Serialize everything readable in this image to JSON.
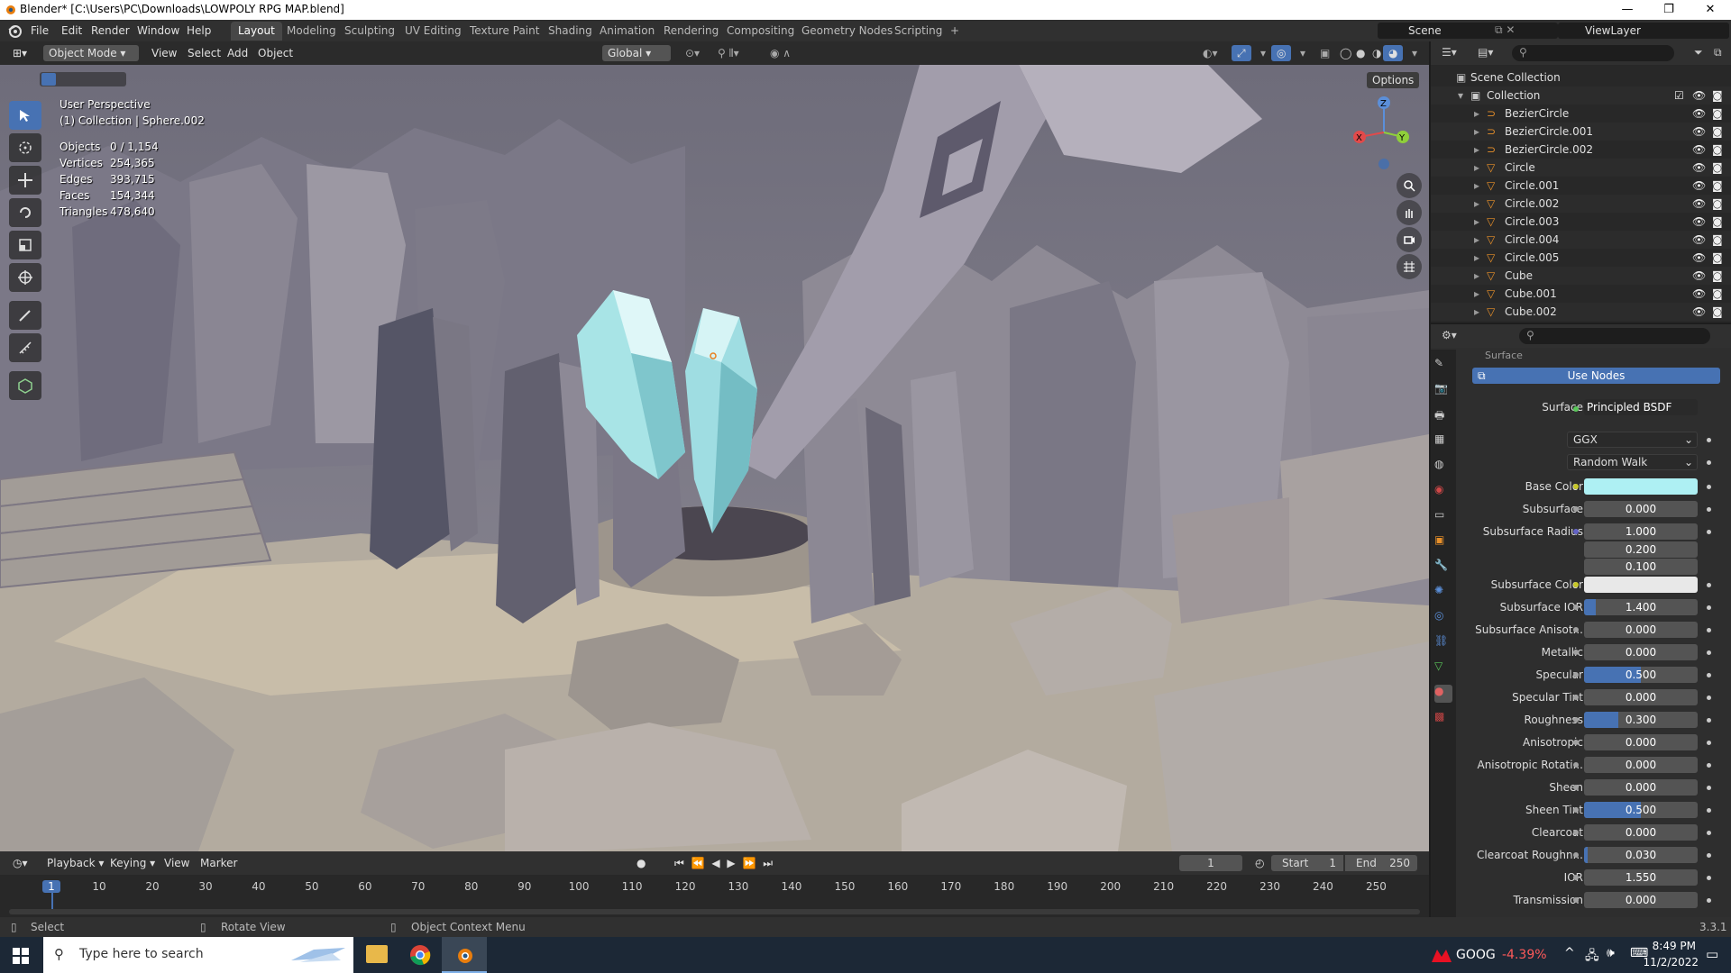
{
  "window": {
    "title": "Blender* [C:\\Users\\PC\\Downloads\\LOWPOLY RPG MAP.blend]",
    "controls": [
      "—",
      "❐",
      "✕"
    ]
  },
  "menu": [
    "File",
    "Edit",
    "Render",
    "Window",
    "Help"
  ],
  "workspaces": [
    "Layout",
    "Modeling",
    "Sculpting",
    "UV Editing",
    "Texture Paint",
    "Shading",
    "Animation",
    "Rendering",
    "Compositing",
    "Geometry Nodes",
    "Scripting",
    "+"
  ],
  "scene": {
    "label": "Scene",
    "viewlayer": "ViewLayer"
  },
  "viewport_header": {
    "mode": "Object Mode",
    "view": "View",
    "select": "Select",
    "add": "Add",
    "object": "Object",
    "orientation": "Global",
    "options": "Options"
  },
  "overlay": {
    "perspective": "User Perspective",
    "collection": "(1) Collection | Sphere.002",
    "stats": [
      {
        "label": "Objects",
        "value": "0 / 1,154"
      },
      {
        "label": "Vertices",
        "value": "254,365"
      },
      {
        "label": "Edges",
        "value": "393,715"
      },
      {
        "label": "Faces",
        "value": "154,344"
      },
      {
        "label": "Triangles",
        "value": "478,640"
      }
    ],
    "gizmo_axes": {
      "x": "X",
      "y": "Y",
      "z": "Z"
    }
  },
  "tools": [
    "select-box-icon",
    "cursor-icon",
    "move-icon",
    "rotate-icon",
    "scale-icon",
    "transform-icon",
    "annotate-icon",
    "measure-icon",
    "add-cube-icon"
  ],
  "outliner": {
    "root": "Scene Collection",
    "collection": "Collection",
    "items": [
      {
        "name": "BezierCircle",
        "type": "curve"
      },
      {
        "name": "BezierCircle.001",
        "type": "curve"
      },
      {
        "name": "BezierCircle.002",
        "type": "curve"
      },
      {
        "name": "Circle",
        "type": "mesh"
      },
      {
        "name": "Circle.001",
        "type": "mesh"
      },
      {
        "name": "Circle.002",
        "type": "mesh"
      },
      {
        "name": "Circle.003",
        "type": "mesh"
      },
      {
        "name": "Circle.004",
        "type": "mesh"
      },
      {
        "name": "Circle.005",
        "type": "mesh"
      },
      {
        "name": "Cube",
        "type": "mesh"
      },
      {
        "name": "Cube.001",
        "type": "mesh"
      },
      {
        "name": "Cube.002",
        "type": "mesh"
      }
    ]
  },
  "properties": {
    "section": "Surface",
    "use_nodes": "Use Nodes",
    "surface_label": "Surface",
    "surface_value": "Principled BSDF",
    "distribution": "GGX",
    "subsurface_method": "Random Walk",
    "rows": [
      {
        "label": "Base Color",
        "type": "color",
        "color": "#aef0f3",
        "dot": "y"
      },
      {
        "label": "Subsurface",
        "value": "0.000",
        "fill": 0
      },
      {
        "label": "Subsurface Radius",
        "value": "1.000",
        "fill": 0,
        "dot": "p"
      },
      {
        "label": "",
        "value": "0.200",
        "fill": 0,
        "nodot": true
      },
      {
        "label": "",
        "value": "0.100",
        "fill": 0,
        "nodot": true
      },
      {
        "label": "Subsurface Color",
        "type": "color",
        "color": "#e8e8e8",
        "dot": "y"
      },
      {
        "label": "Subsurface IOR",
        "value": "1.400",
        "fill": 0.1
      },
      {
        "label": "Subsurface Anisot...",
        "value": "0.000",
        "fill": 0
      },
      {
        "label": "Metallic",
        "value": "0.000",
        "fill": 0
      },
      {
        "label": "Specular",
        "value": "0.500",
        "fill": 0.5
      },
      {
        "label": "Specular Tint",
        "value": "0.000",
        "fill": 0
      },
      {
        "label": "Roughness",
        "value": "0.300",
        "fill": 0.3
      },
      {
        "label": "Anisotropic",
        "value": "0.000",
        "fill": 0
      },
      {
        "label": "Anisotropic Rotati...",
        "value": "0.000",
        "fill": 0
      },
      {
        "label": "Sheen",
        "value": "0.000",
        "fill": 0
      },
      {
        "label": "Sheen Tint",
        "value": "0.500",
        "fill": 0.5
      },
      {
        "label": "Clearcoat",
        "value": "0.000",
        "fill": 0
      },
      {
        "label": "Clearcoat Roughn...",
        "value": "0.030",
        "fill": 0.03
      },
      {
        "label": "IOR",
        "value": "1.550",
        "fill": 0
      },
      {
        "label": "Transmission",
        "value": "0.000",
        "fill": 0
      }
    ]
  },
  "timeline": {
    "menus": [
      "Playback",
      "Keying",
      "View",
      "Marker"
    ],
    "current_frame": "1",
    "start_label": "Start",
    "start": "1",
    "end_label": "End",
    "end": "250",
    "ticks": [
      "1",
      "10",
      "20",
      "30",
      "40",
      "50",
      "60",
      "70",
      "80",
      "90",
      "100",
      "110",
      "120",
      "130",
      "140",
      "150",
      "160",
      "170",
      "180",
      "190",
      "200",
      "210",
      "220",
      "230",
      "240",
      "250"
    ]
  },
  "statusbar": {
    "select": "Select",
    "rotate": "Rotate View",
    "context": "Object Context Menu",
    "version": "3.3.1"
  },
  "taskbar": {
    "search_placeholder": "Type here to search",
    "stock_symbol": "GOOG",
    "stock_change": "-4.39%",
    "time": "8:49 PM",
    "date": "11/2/2022"
  },
  "colors": {
    "accent": "#4772b3",
    "crystal": "#9fdde2",
    "stone": "#8a8794"
  }
}
